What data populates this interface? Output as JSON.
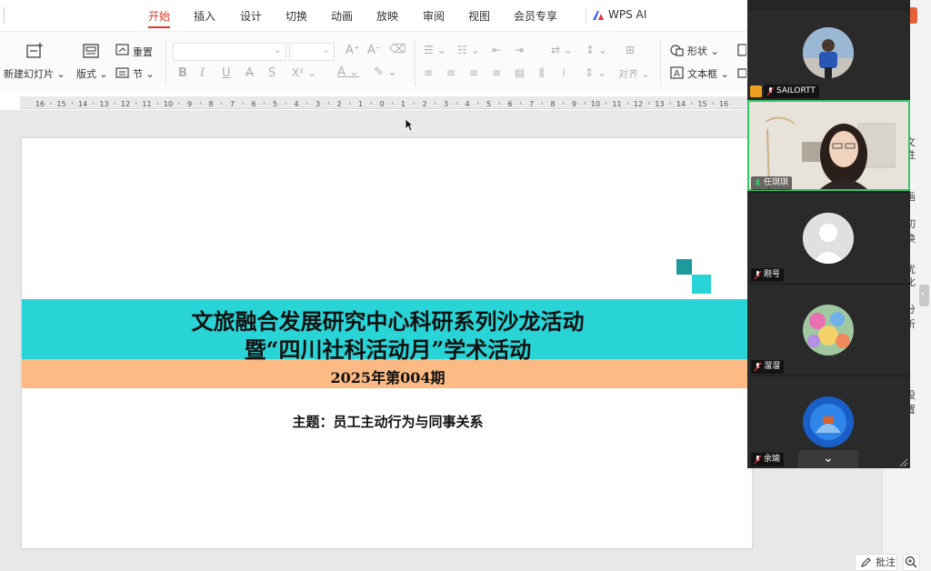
{
  "menu": {
    "tabs": [
      {
        "label": "开始",
        "active": true
      },
      {
        "label": "插入"
      },
      {
        "label": "设计"
      },
      {
        "label": "切换"
      },
      {
        "label": "动画"
      },
      {
        "label": "放映"
      },
      {
        "label": "审阅"
      },
      {
        "label": "视图"
      },
      {
        "label": "会员专享"
      }
    ],
    "wps_ai": "WPS AI"
  },
  "ribbon": {
    "new_slide": "新建幻灯片",
    "layout": "版式",
    "reset": "重置",
    "section": "节",
    "align": "对齐",
    "shape": "形状",
    "textbox": "文本框"
  },
  "ruler": {
    "ticks": [
      "16",
      "15",
      "14",
      "13",
      "12",
      "11",
      "10",
      "9",
      "8",
      "7",
      "6",
      "5",
      "4",
      "3",
      "2",
      "1",
      "0",
      "1",
      "2",
      "3",
      "4",
      "5",
      "6",
      "7",
      "8",
      "9",
      "10",
      "11",
      "12",
      "13",
      "14",
      "15",
      "16"
    ]
  },
  "slide": {
    "title_line1": "文旅融合发展研究中心科研系列沙龙活动",
    "title_line2": "暨“四川社科活动月”学术活动",
    "issue": "2025年第004期",
    "topic": "主题：员工主动行为与同事关系",
    "colors": {
      "title_band": "#29d4d6",
      "issue_band": "#fdba84",
      "deco_dark": "#1e9a9c",
      "deco_light": "#29d4d6"
    }
  },
  "side_panel": {
    "chars": [
      "文",
      "性",
      "画",
      "切",
      "换",
      "优",
      "化",
      "分",
      "析",
      "设",
      "置"
    ]
  },
  "bottom": {
    "comment": "批注"
  },
  "video_call": {
    "participants": [
      {
        "name": "SAILORTT",
        "host": true,
        "muted": true
      },
      {
        "name": "任琪琪",
        "speaking": true,
        "muted": false
      },
      {
        "name": "刚号",
        "muted": true
      },
      {
        "name": "溜溜",
        "muted": true
      },
      {
        "name": "余瑜",
        "muted": true
      }
    ]
  }
}
